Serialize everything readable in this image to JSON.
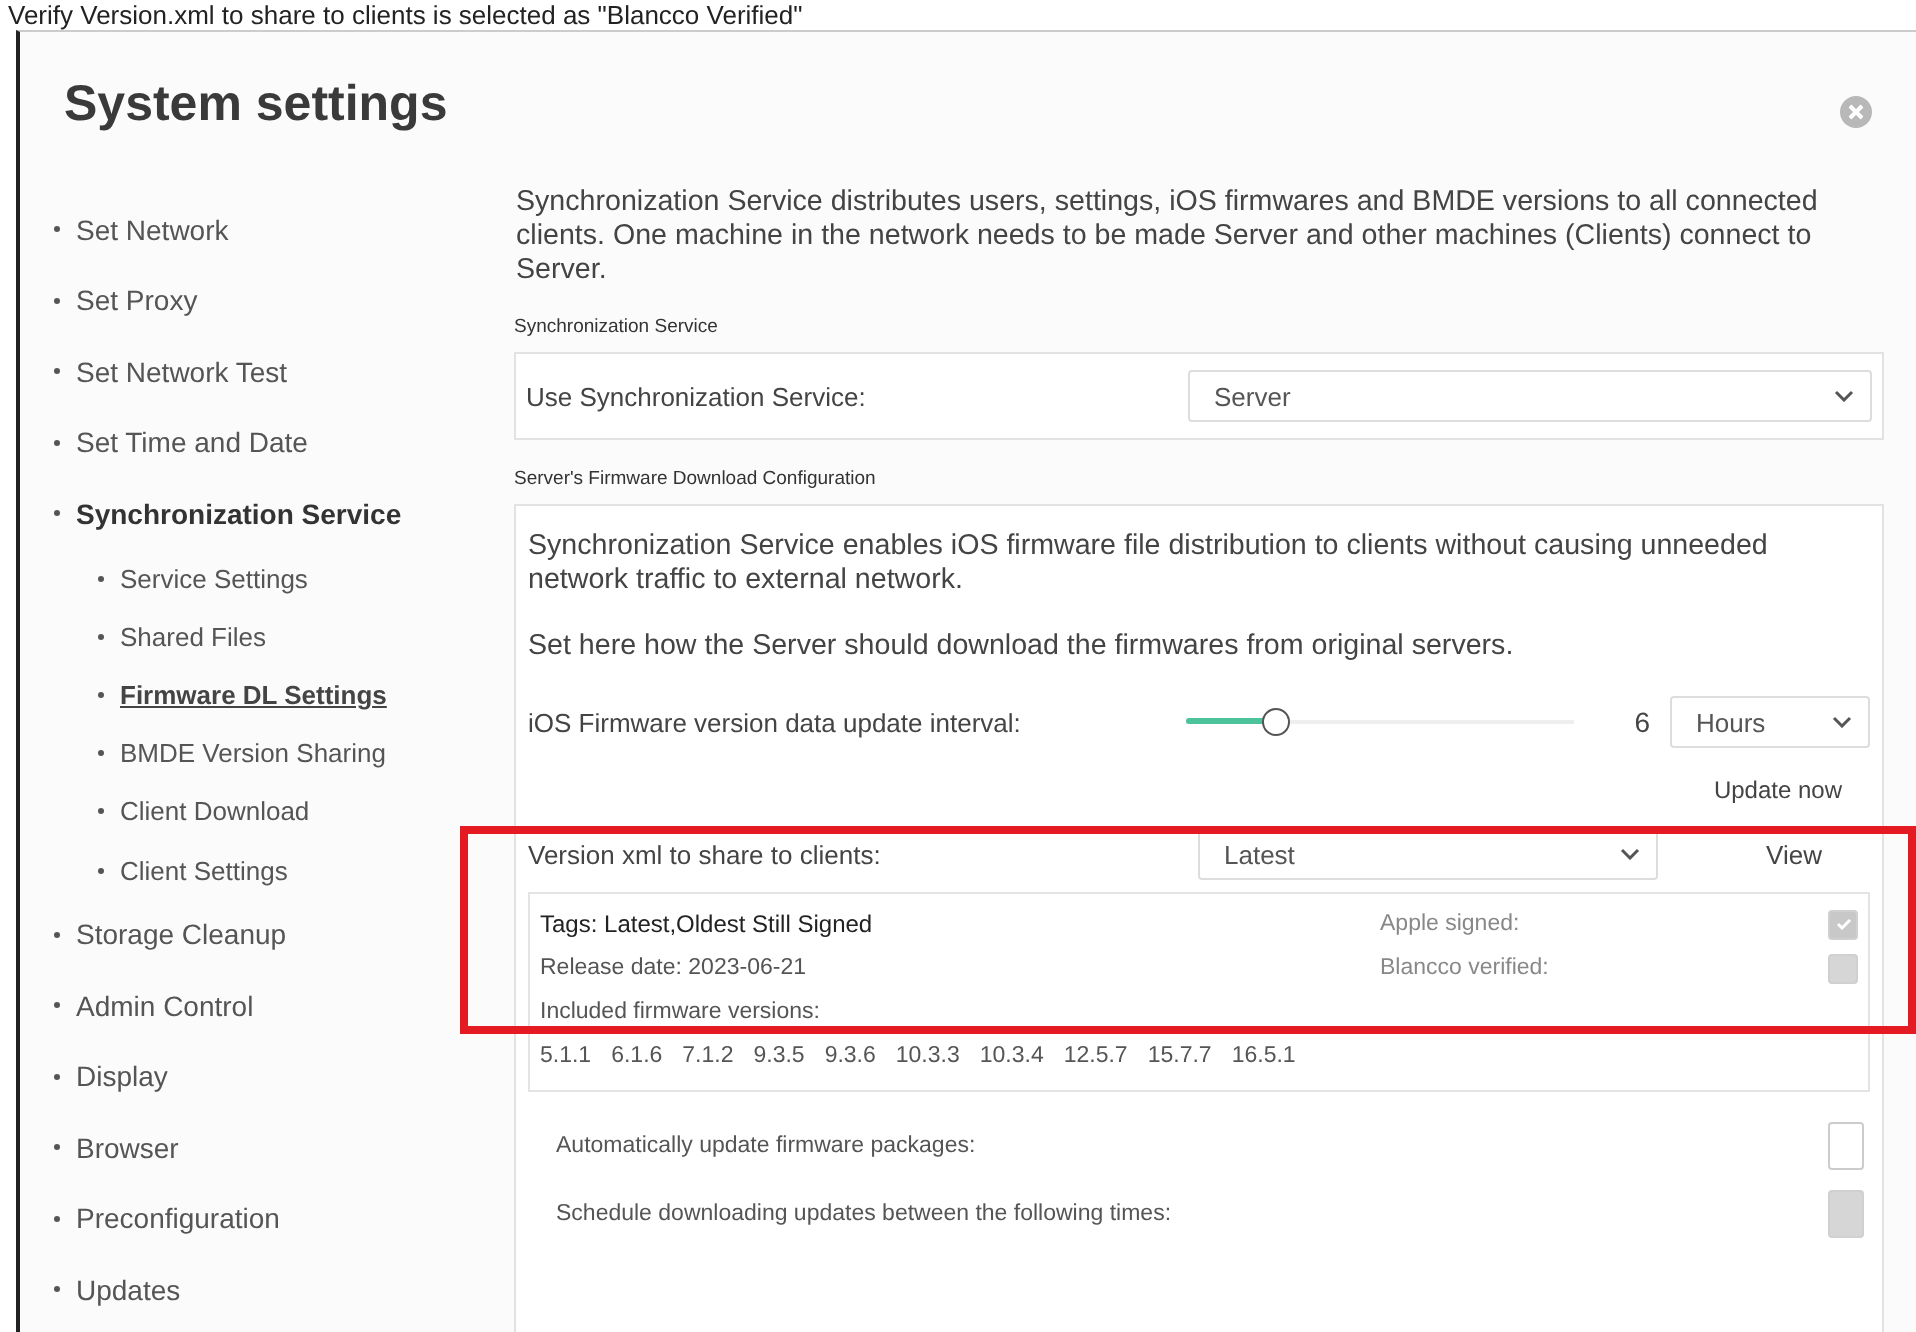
{
  "caption": "Verify Version.xml to share to clients is selected as \"Blancco Verified\"",
  "window": {
    "title": "System settings"
  },
  "sidebar": {
    "items": [
      {
        "label": "Set Network",
        "selected": false
      },
      {
        "label": "Set Proxy",
        "selected": false
      },
      {
        "label": "Set Network Test",
        "selected": false
      },
      {
        "label": "Set Time and Date",
        "selected": false
      },
      {
        "label": "Synchronization Service",
        "selected": true,
        "children": [
          {
            "label": "Service Settings",
            "selected": false
          },
          {
            "label": "Shared Files",
            "selected": false
          },
          {
            "label": "Firmware DL Settings",
            "selected": true
          },
          {
            "label": "BMDE Version Sharing",
            "selected": false
          },
          {
            "label": "Client Download",
            "selected": false
          },
          {
            "label": "Client Settings",
            "selected": false
          }
        ]
      },
      {
        "label": "Storage Cleanup",
        "selected": false
      },
      {
        "label": "Admin Control",
        "selected": false
      },
      {
        "label": "Display",
        "selected": false
      },
      {
        "label": "Browser",
        "selected": false
      },
      {
        "label": "Preconfiguration",
        "selected": false
      },
      {
        "label": "Updates",
        "selected": false
      }
    ]
  },
  "intro": "Synchronization Service distributes users, settings, iOS firmwares and BMDE versions to all connected clients. One machine in the network needs to be made Server and other machines (Clients) connect to Server.",
  "sync_section": {
    "heading": "Synchronization Service",
    "label": "Use Synchronization Service:",
    "value": "Server"
  },
  "firmware_section": {
    "heading": "Server's Firmware Download Configuration",
    "description": "Synchronization Service enables iOS firmware file distribution to clients without causing unneeded network traffic to external network.",
    "instruction": "Set here how the Server should download the firmwares from original servers.",
    "interval": {
      "label": "iOS Firmware version data update interval:",
      "level": 0.23,
      "reading": "6",
      "unit": "Hours"
    },
    "update_now": "Update now",
    "version_xml": {
      "label": "Version xml to share to clients:",
      "value": "Latest",
      "view_button": "View"
    },
    "details": {
      "tags": "Tags: Latest,Oldest Still Signed",
      "release_date": "Release date: 2023-06-21",
      "included_label": "Included firmware versions:",
      "versions": [
        "5.1.1",
        "6.1.6",
        "7.1.2",
        "9.3.5",
        "9.3.6",
        "10.3.3",
        "10.3.4",
        "12.5.7",
        "15.7.7",
        "16.5.1"
      ],
      "flags": [
        {
          "label": "Apple signed:",
          "checked": true,
          "disabled": true
        },
        {
          "label": "Blancco verified:",
          "checked": false,
          "disabled": true
        }
      ]
    },
    "options": [
      {
        "label": "Automatically update firmware packages:",
        "checked": false,
        "disabled": false
      },
      {
        "label": "Schedule downloading updates between the following times:",
        "checked": false,
        "disabled": true
      }
    ]
  }
}
